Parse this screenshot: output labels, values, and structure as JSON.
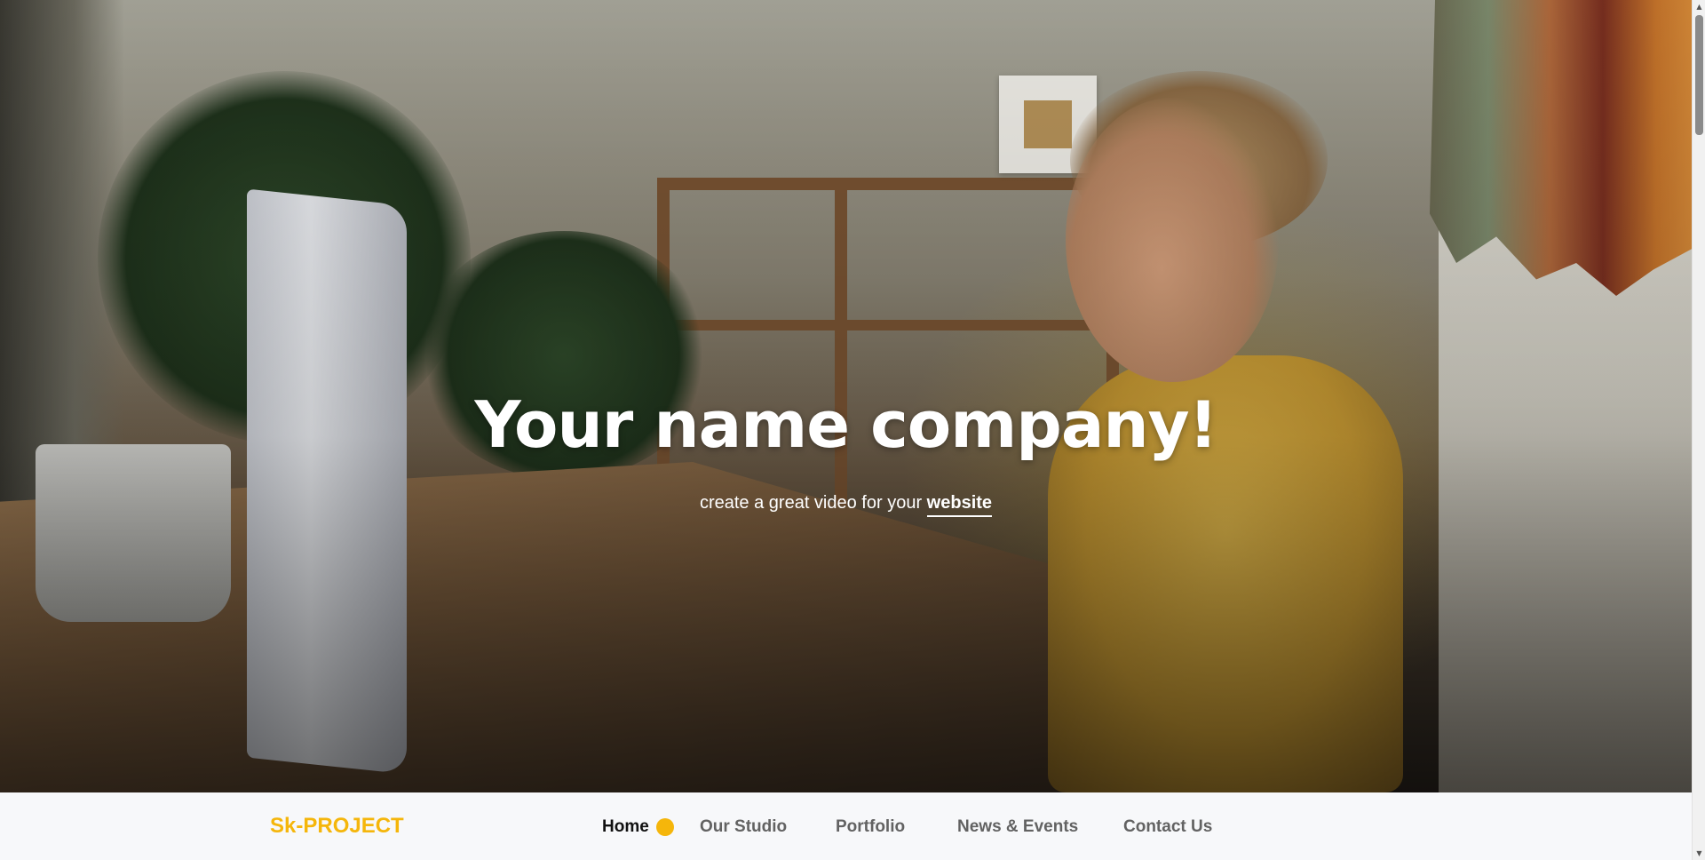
{
  "hero": {
    "title": "Your name company!",
    "subtitle_prefix": "create a great video for your",
    "subtitle_highlight": "website"
  },
  "navbar": {
    "brand": "Sk-PROJECT",
    "items": [
      {
        "label": "Home",
        "active": true
      },
      {
        "label": "Our Studio",
        "active": false
      },
      {
        "label": "Portfolio",
        "active": false
      },
      {
        "label": "News & Events",
        "active": false
      },
      {
        "label": "Contact Us",
        "active": false
      }
    ]
  },
  "colors": {
    "accent": "#f5b60b",
    "navbar_background": "#f7f8fa",
    "nav_text": "#626262",
    "nav_active_text": "#111111"
  },
  "icons": {
    "active_indicator": "dot-icon",
    "scroll_up": "arrow-up-icon",
    "scroll_down": "arrow-down-icon"
  }
}
